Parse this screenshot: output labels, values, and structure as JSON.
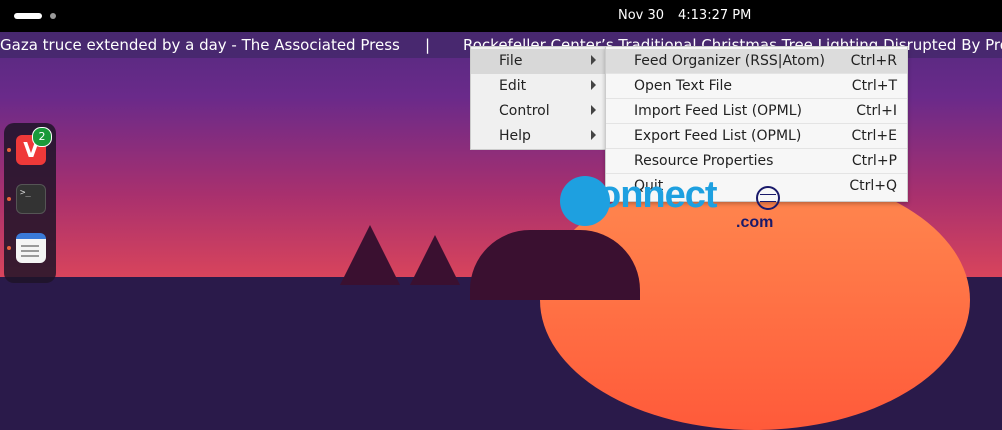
{
  "topbar": {
    "date": "Nov 30",
    "time": "4:13:27 PM"
  },
  "ticker": {
    "headline1": "Gaza truce extended by a day - The Associated Press",
    "separator": "|",
    "headline2": "Rockefeller Center’s Traditional Christmas Tree Lighting Disrupted By Pro"
  },
  "dock": {
    "apps": [
      {
        "name": "vivaldi-icon",
        "glyph": "V",
        "badge": "2"
      },
      {
        "name": "terminal-icon",
        "glyph": ">_"
      },
      {
        "name": "text-editor-icon"
      }
    ]
  },
  "menubar": {
    "items": [
      {
        "label": "File",
        "active": true
      },
      {
        "label": "Edit"
      },
      {
        "label": "Control"
      },
      {
        "label": "Help"
      }
    ]
  },
  "file_menu": {
    "items": [
      {
        "label": "Feed Organizer (RSS|Atom)",
        "shortcut": "Ctrl+R",
        "active": true
      },
      {
        "label": "Open Text File",
        "shortcut": "Ctrl+T"
      },
      {
        "label": "Import Feed List (OPML)",
        "shortcut": "Ctrl+I"
      },
      {
        "label": "Export Feed List (OPML)",
        "shortcut": "Ctrl+E"
      },
      {
        "label": "Resource Properties",
        "shortcut": "Ctrl+P"
      },
      {
        "label": "Quit",
        "shortcut": "Ctrl+Q"
      }
    ]
  },
  "watermark": {
    "text": "onnect",
    "suffix": ".com"
  },
  "colors": {
    "logo_blue": "#1ea0e0",
    "logo_navy": "#1a1a6a",
    "badge_green": "#1a9a3a"
  }
}
